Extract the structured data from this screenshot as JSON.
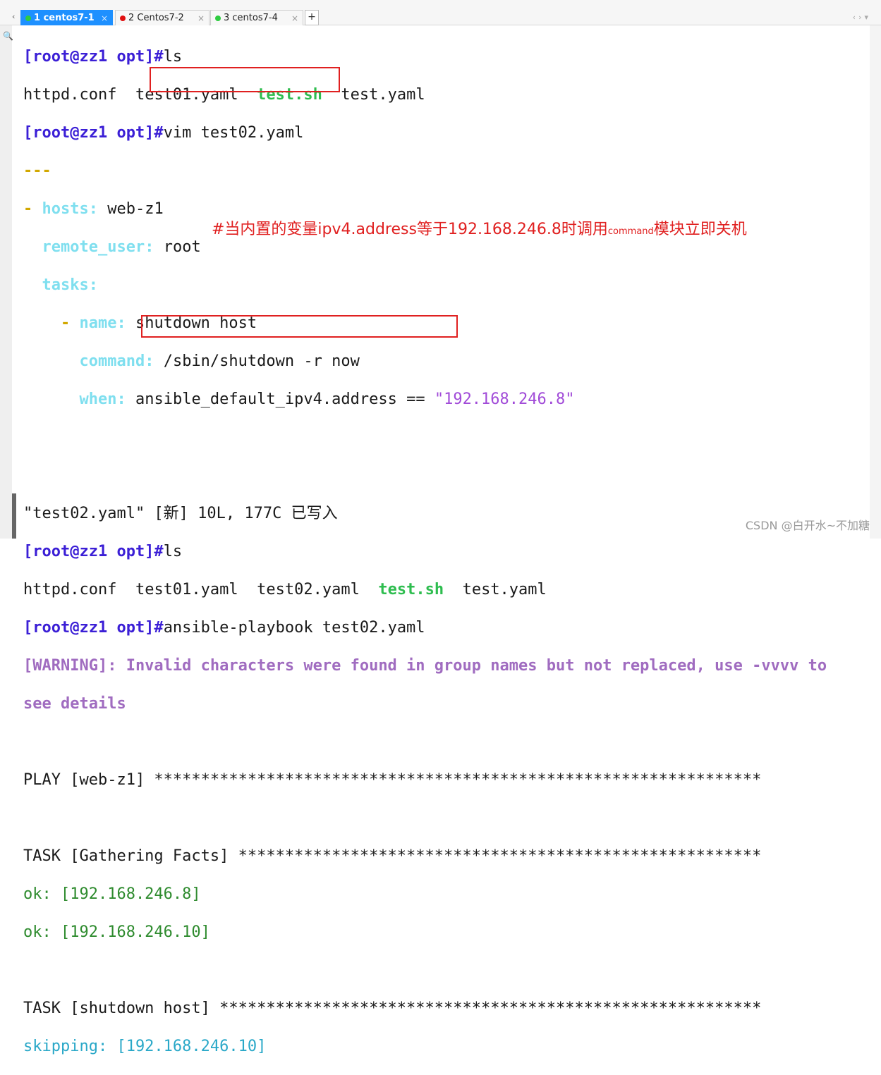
{
  "tabs": [
    {
      "label": "1 centos7-1",
      "status_color": "#2ecc40",
      "active": true
    },
    {
      "label": "2 Centos7-2",
      "status_color": "#e01010",
      "active": false
    },
    {
      "label": "3 centos7-4",
      "status_color": "#2ecc40",
      "active": false
    }
  ],
  "tab_add_label": "+",
  "tab_close_label": "×",
  "tab_nav": {
    "left": "‹",
    "right": "›",
    "menu": "▾"
  },
  "terminal": {
    "prompt": "[root@zz1 opt]#",
    "cmd_ls": "ls",
    "ls1": {
      "a": "httpd.conf",
      "b": "test01.yaml",
      "exe": "test.sh",
      "c": "test.yaml"
    },
    "cmd_vim": "vim test02.yaml",
    "yaml": {
      "doc_start": "---",
      "dash": "-",
      "hosts_key": "hosts:",
      "hosts_val": "web-z1",
      "remote_user_key": "remote_user:",
      "remote_user_val": "root",
      "tasks_key": "tasks:",
      "name_key": "name:",
      "name_val": "shutdown host",
      "command_key": "command:",
      "command_val": "/sbin/shutdown -r now",
      "when_key": "when:",
      "when_val": "ansible_default_ipv4.address ==",
      "when_str": "\"192.168.246.8\""
    },
    "written_msg": "\"test02.yaml\" [新] 10L, 177C 已写入",
    "ls2": {
      "a": "httpd.conf",
      "b": "test01.yaml",
      "c": "test02.yaml",
      "exe": "test.sh",
      "d": "test.yaml"
    },
    "cmd_playbook": "ansible-playbook test02.yaml",
    "warning_line1": "[WARNING]: Invalid characters were found in group names but not replaced, use -vvvv to",
    "warning_line2": "see details",
    "play_line": "PLAY [web-z1] *****************************************************************",
    "task1_line": "TASK [Gathering Facts] ********************************************************",
    "ok1": "ok: [192.168.246.8]",
    "ok2": "ok: [192.168.246.10]",
    "task2_line": "TASK [shutdown host] **********************************************************",
    "skipping": "skipping: [192.168.246.10]"
  },
  "annotation": {
    "part1": "#当内置的变量ipv4.address等于192.168.246.8时调用",
    "small": "command",
    "part2": "模块立即关机",
    "color": "#e02020"
  },
  "watermark": "CSDN @白开水~不加糖"
}
